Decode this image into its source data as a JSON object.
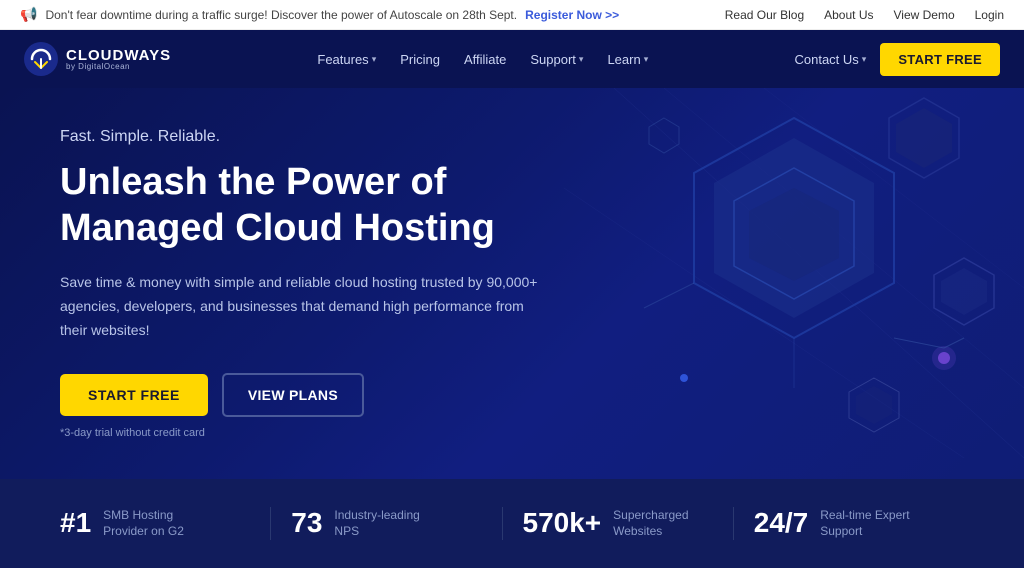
{
  "announcement": {
    "icon": "📢",
    "text": "Don't fear downtime during a traffic surge! Discover the power of Autoscale on 28th Sept.",
    "link_text": "Register Now >>",
    "right_links": [
      {
        "label": "Read Our Blog",
        "href": "#"
      },
      {
        "label": "About Us",
        "href": "#"
      },
      {
        "label": "View Demo",
        "href": "#"
      },
      {
        "label": "Login",
        "href": "#"
      }
    ]
  },
  "navbar": {
    "logo_main": "CLOUDWAYS",
    "logo_sub": "by DigitalOcean",
    "nav_items": [
      {
        "label": "Features",
        "has_dropdown": true
      },
      {
        "label": "Pricing",
        "has_dropdown": false
      },
      {
        "label": "Affiliate",
        "has_dropdown": false
      },
      {
        "label": "Support",
        "has_dropdown": true
      },
      {
        "label": "Learn",
        "has_dropdown": true
      }
    ],
    "contact_label": "Contact Us",
    "start_free_label": "START FREE"
  },
  "hero": {
    "tagline": "Fast. Simple. Reliable.",
    "title": "Unleash the Power of Managed Cloud Hosting",
    "description": "Save time & money with simple and reliable cloud hosting trusted by 90,000+ agencies, developers, and businesses that demand high performance from their websites!",
    "btn_start": "START FREE",
    "btn_plans": "VIEW PLANS",
    "note": "*3-day trial without credit card"
  },
  "stats": [
    {
      "number": "#1",
      "label": "SMB Hosting Provider on G2"
    },
    {
      "number": "73",
      "label": "Industry-leading NPS"
    },
    {
      "number": "570k+",
      "label": "Supercharged Websites"
    },
    {
      "number": "24/7",
      "label": "Real-time Expert Support"
    }
  ]
}
